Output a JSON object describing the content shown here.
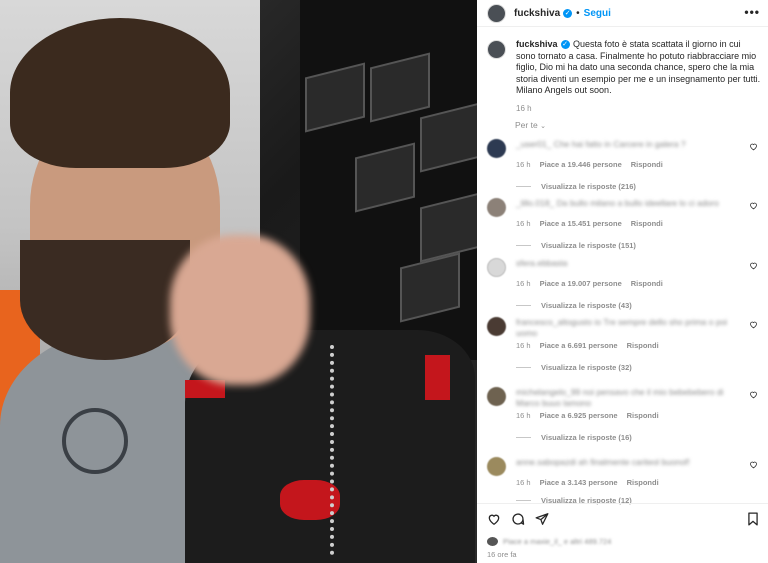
{
  "post": {
    "username": "fuckshiva",
    "follow_label": "Segui",
    "more_label": "•••",
    "caption_text": " Questa foto è stata scattata il giorno in cui sono tornato a casa. Finalmente ho potuto riabbracciare mio figlio, Dio mi ha dato una seconda chance, spero che la mia storia diventi un esempio per me e un insegnamento per tutti. Milano Angels out soon.",
    "caption_time": "16 h",
    "translate_label": "Per te",
    "posted_ago": "16 ore fa",
    "liked_by": "Piace a maxie_il_ e altri 489.724"
  },
  "comments": [
    {
      "text": "_user01_ Che hai fatto in Carcere in galera ?",
      "time": "16 h",
      "likes": "Piace a 19.446 persone",
      "reply": "Rispondi",
      "view_replies": "Visualizza le risposte (216)",
      "avatar_color": "#2d3a52"
    },
    {
      "text": "_lillo.018_ Da bullo milano a bullo ideellare lo ci adoro",
      "time": "16 h",
      "likes": "Piace a 15.451 persone",
      "reply": "Rispondi",
      "view_replies": "Visualizza le risposte (151)",
      "avatar_color": "#8c8178"
    },
    {
      "text": "sfera.ebbasta",
      "time": "16 h",
      "likes": "Piace a 19.007 persone",
      "reply": "Rispondi",
      "view_replies": "Visualizza le risposte (43)",
      "avatar_color": "#d8d8d8"
    },
    {
      "text": "francesco_altogusto io Tre sempre dello sho prima o poi uomo",
      "time": "16 h",
      "likes": "Piace a 6.691 persone",
      "reply": "Rispondi",
      "view_replies": "Visualizza le risposte (32)",
      "avatar_color": "#4a3b33"
    },
    {
      "text": "michelangelo_99 noi pensavo che il mio bebebebero di Marco buuo lamono",
      "time": "16 h",
      "likes": "Piace a 6.925 persone",
      "reply": "Rispondi",
      "view_replies": "Visualizza le risposte (16)",
      "avatar_color": "#6e6250"
    },
    {
      "text": "anne.sabopazdi ah finalmente cariteol buonof!",
      "time": "16 h",
      "likes": "Piace a 3.143 persone",
      "reply": "Rispondi",
      "view_replies": "Visualizza le risposte (12)",
      "avatar_color": "#9b8a5e"
    }
  ],
  "icons": {
    "verified": "verified-badge-icon",
    "like": "heart-icon",
    "comment": "comment-icon",
    "share": "share-icon",
    "save": "bookmark-icon"
  },
  "colors": {
    "accent": "#0095f6",
    "muted": "#8e8e8e"
  }
}
